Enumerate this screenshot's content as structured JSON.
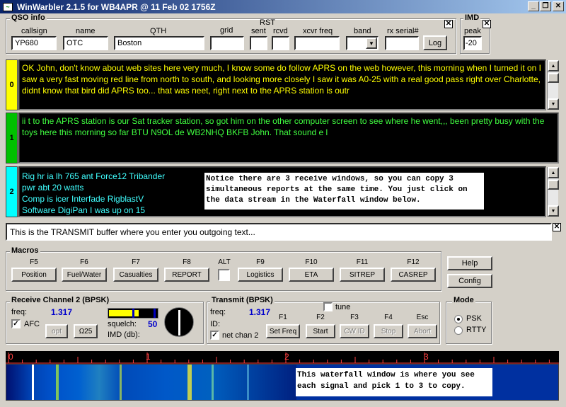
{
  "window": {
    "title": "WinWarbler 2.1.5 for WB4APR @ 11 Feb 02  1756Z",
    "minimize": "_",
    "restore": "❐",
    "close": "✕"
  },
  "qso": {
    "label": "QSO info",
    "close": "✕",
    "callsign": {
      "label": "callsign",
      "value": "YP680"
    },
    "name": {
      "label": "name",
      "value": "OTC"
    },
    "qth": {
      "label": "QTH",
      "value": "Boston"
    },
    "grid": {
      "label": "grid",
      "value": ""
    },
    "rst": {
      "label": "RST",
      "sent_label": "sent",
      "rcvd_label": "rcvd",
      "sent": "",
      "rcvd": ""
    },
    "xcvr_freq": {
      "label": "xcvr freq",
      "value": ""
    },
    "band": {
      "label": "band",
      "value": ""
    },
    "rx_serial": {
      "label": "rx serial#",
      "value": ""
    },
    "log_button": "Log"
  },
  "imd": {
    "label": "IMD",
    "peak_label": "peak",
    "peak_value": "-20",
    "close": "✕"
  },
  "receive_windows": [
    {
      "index": "0",
      "color": "#ffff00",
      "text_color": "#ffff00",
      "text": "OK  John,  don't know about web sites here very much,  I know some do follow  APRS on the web however,   this morning when I turned it on  I saw a very fast moving red line  from north to south,   and looking more closely I saw it was  A0-25  with a real good pass right over Charlotte,   didnt know that  bird  did  APRS  too... that was neet,  right next to the APRS station is outr"
    },
    {
      "index": "1",
      "color": "#00c000",
      "text_color": "#40ff40",
      "text": "ii t to the APRS station is our Sat  tracker station,  so got him on the other computer screen to see where he went,,,   been pretty busy with the toys here this morning so far  BTU N9OL de WB2NHQ BKFB John.  That sound e l"
    },
    {
      "index": "2",
      "color": "#00ffff",
      "text_color": "#40ffff",
      "lines": [
        "Rig hr ia lh 765  ant Force12 Tribander",
        "pwr abt 20 watts",
        "Comp is  icer Interfade RigblastV",
        "Software DigiPan  I was up on 15"
      ]
    }
  ],
  "notice_receive": "Notice there are 3 receive windows, so you can copy 3 simultaneous reports at the same time.  You just click on the data stream in the Waterfall window below.",
  "transmit_buffer": {
    "text": "This  is the TRANSMIT buffer where you enter you  outgoing text...",
    "close": "✕"
  },
  "macros": {
    "label": "Macros",
    "keys": [
      {
        "key": "F5",
        "label": "Position"
      },
      {
        "key": "F6",
        "label": "Fuel/Water"
      },
      {
        "key": "F7",
        "label": "Casualties"
      },
      {
        "key": "F8",
        "label": "REPORT"
      },
      {
        "key": "F9",
        "label": "Logistics"
      },
      {
        "key": "F10",
        "label": "ETA"
      },
      {
        "key": "F11",
        "label": "SITREP"
      },
      {
        "key": "F12",
        "label": "CASREP"
      }
    ],
    "alt_label": "ALT"
  },
  "help_button": "Help",
  "config_button": "Config",
  "receive_channel": {
    "label": "Receive Channel 2 (BPSK)",
    "freq_label": "freq:",
    "freq_value": "1.317",
    "afc_label": "AFC",
    "afc_checked": "✓",
    "opt_button": "opt",
    "omega_button": "Ω25",
    "squelch_label": "squelch:",
    "squelch_value": "50",
    "imd_label": "IMD (db):",
    "squelch_level": 0.62
  },
  "transmit": {
    "label": "Transmit (BPSK)",
    "tune_label": "tune",
    "freq_label": "freq:",
    "freq_value": "1.317",
    "id_label": "ID:",
    "netchan_label": "net chan 2",
    "netchan_checked": "✓",
    "buttons": [
      {
        "key": "F1",
        "label": "Set Freq",
        "enabled": true
      },
      {
        "key": "F2",
        "label": "Start",
        "enabled": true
      },
      {
        "key": "F3",
        "label": "CW ID",
        "enabled": false
      },
      {
        "key": "F4",
        "label": "Stop",
        "enabled": false
      },
      {
        "key": "Esc",
        "label": "Abort",
        "enabled": false
      }
    ]
  },
  "mode": {
    "label": "Mode",
    "options": [
      "PSK",
      "RTTY"
    ],
    "selected": "PSK"
  },
  "waterfall": {
    "scale": [
      "0",
      "1",
      "2",
      "3"
    ],
    "notice": "This waterfall window is where you see each signal and pick 1 to 3 to copy."
  },
  "colors": {
    "title_start": "#0a246a",
    "title_end": "#a6caf0",
    "face": "#d4d0c8",
    "accent_blue": "#0000cc"
  }
}
